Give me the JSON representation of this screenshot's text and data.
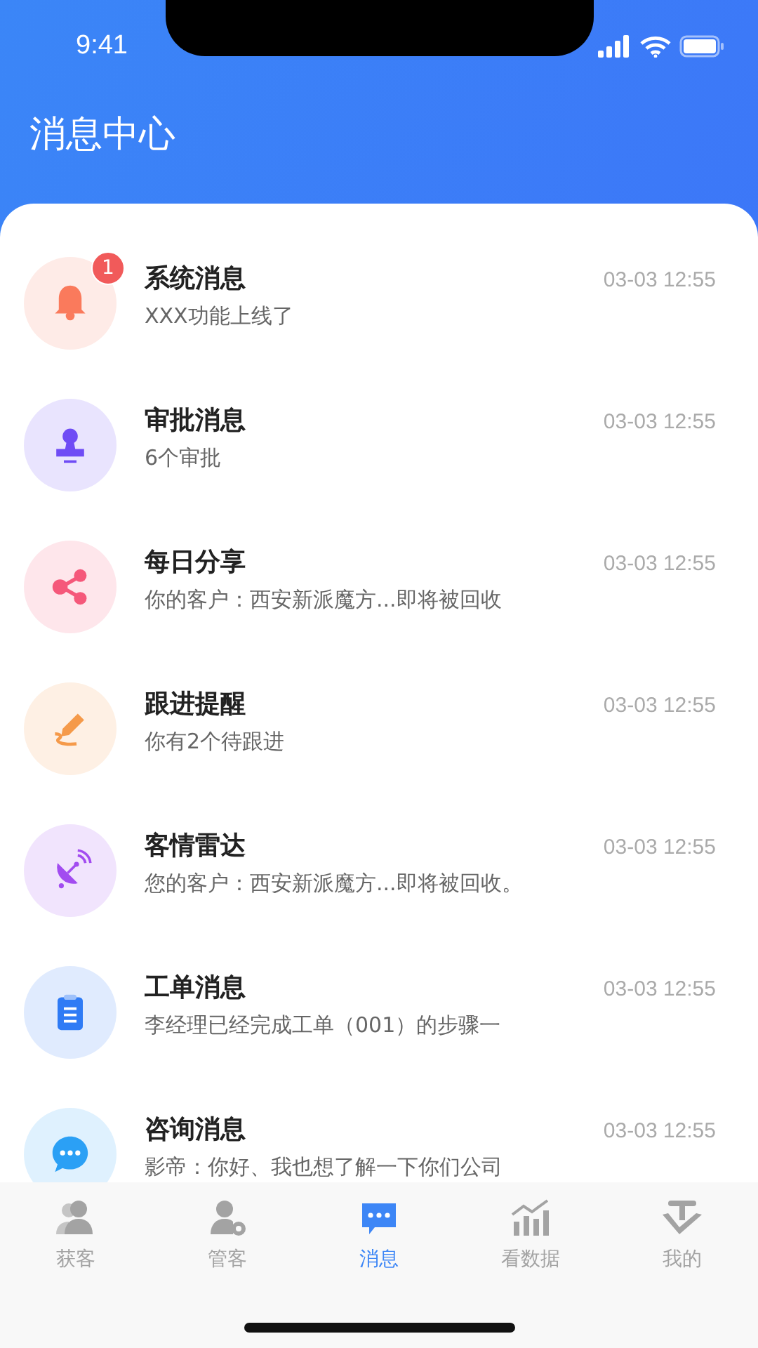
{
  "status_bar": {
    "time": "9:41"
  },
  "header": {
    "title": "消息中心"
  },
  "messages": [
    {
      "kind": "bell",
      "color": "#fa7a5c",
      "title": "系统消息",
      "preview": "XXX功能上线了",
      "time": "03-03 12:55",
      "badge": "1"
    },
    {
      "kind": "stamp",
      "color": "#6f4cf5",
      "title": "审批消息",
      "preview": "6个审批",
      "time": "03-03 12:55"
    },
    {
      "kind": "share",
      "color": "#f5587a",
      "title": "每日分享",
      "preview": "你的客户：西安新派魔方...即将被回收",
      "time": "03-03 12:55"
    },
    {
      "kind": "pen",
      "color": "#f59a4a",
      "title": "跟进提醒",
      "preview": "你有2个待跟进",
      "time": "03-03 12:55"
    },
    {
      "kind": "radar",
      "color": "#a24cf0",
      "title": "客情雷达",
      "preview": "您的客户：西安新派魔方...即将被回收。",
      "time": "03-03 12:55"
    },
    {
      "kind": "clipboard",
      "color": "#2f7bf5",
      "title": "工单消息",
      "preview": "李经理已经完成工单（001）的步骤一",
      "time": "03-03 12:55"
    },
    {
      "kind": "chat",
      "color": "#2ba0f5",
      "title": "咨询消息",
      "preview": "影帝：你好、我也想了解一下你们公司",
      "time": "03-03 12:55"
    }
  ],
  "tabs": [
    {
      "kind": "people",
      "label": "获客",
      "selected": false
    },
    {
      "kind": "person-gear",
      "label": "管客",
      "selected": false
    },
    {
      "kind": "chat",
      "label": "消息",
      "selected": true
    },
    {
      "kind": "chart",
      "label": "看数据",
      "selected": false
    },
    {
      "kind": "logo",
      "label": "我的",
      "selected": false
    }
  ]
}
